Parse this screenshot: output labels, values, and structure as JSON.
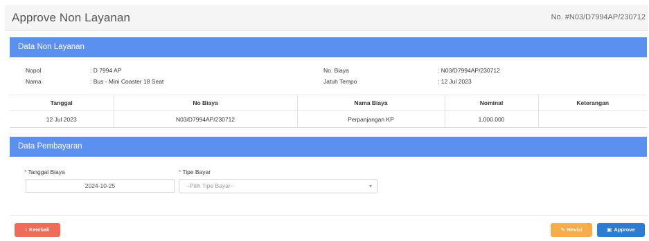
{
  "page": {
    "title": "Approve Non Layanan",
    "doc_no": "No. #N03/D7994AP/230712"
  },
  "section_non_layanan": {
    "title": "Data Non Layanan",
    "nopol_label": "Nopol",
    "nopol_value": ": D 7994 AP",
    "nama_label": "Nama",
    "nama_value": ": Bus - Mini Coaster 18 Seat",
    "no_biaya_label": "No. Biaya",
    "no_biaya_value": ": N03/D7994AP/230712",
    "jatuh_tempo_label": "Jatuh Tempo",
    "jatuh_tempo_value": ": 12 Jul 2023"
  },
  "table": {
    "headers": [
      "Tanggal",
      "No Biaya",
      "Nama Biaya",
      "Nominal",
      "Keterangan"
    ],
    "rows": [
      [
        "12 Jul 2023",
        "N03/D7994AP/230712",
        "Perpanjangan KP",
        "1.000.000",
        ""
      ]
    ]
  },
  "section_pembayaran": {
    "title": "Data Pembayaran",
    "tanggal_label": "Tanggal Biaya",
    "tanggal_value": "2024-10-25",
    "tipe_label": "Tipe Bayar",
    "tipe_placeholder": "--Pilih Tipe Bayar--",
    "required_mark": "*"
  },
  "footer": {
    "back_label": "Kembali",
    "back_icon": "chevron-left-icon",
    "revisi_label": "Revisi",
    "revisi_icon": "edit-icon",
    "approve_label": "Approve",
    "approve_icon": "save-icon"
  },
  "colors": {
    "section_bar": "#5b8ff0",
    "back_button": "#f06b5a",
    "revisi_button": "#f5ad4e",
    "approve_button": "#2e7bd0"
  }
}
